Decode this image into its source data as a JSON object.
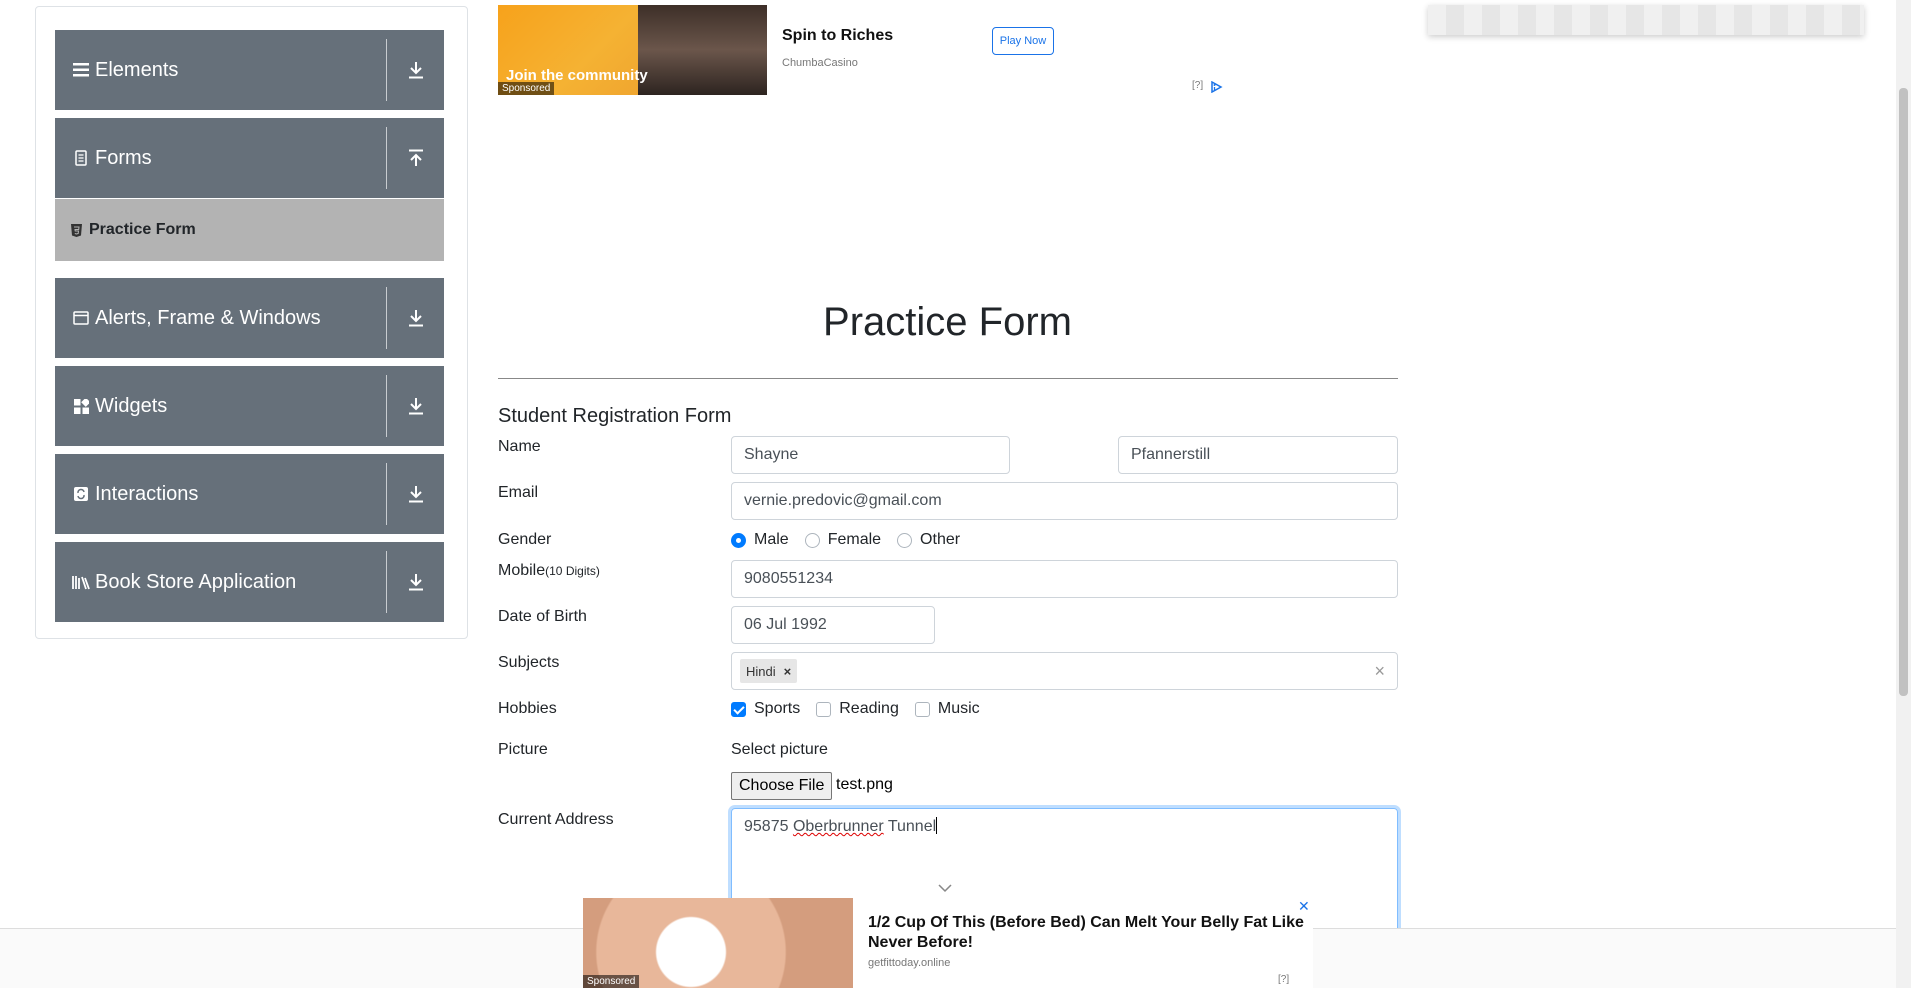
{
  "sidebar": {
    "groups": [
      {
        "label": "Elements",
        "icon": "bars-icon",
        "arrow": "download-icon"
      },
      {
        "label": "Forms",
        "icon": "document-icon",
        "arrow": "upload-icon"
      },
      {
        "label": "Alerts, Frame & Windows",
        "icon": "window-icon",
        "arrow": "download-icon"
      },
      {
        "label": "Widgets",
        "icon": "widgets-icon",
        "arrow": "download-icon"
      },
      {
        "label": "Interactions",
        "icon": "interactions-icon",
        "arrow": "download-icon"
      },
      {
        "label": "Book Store Application",
        "icon": "books-icon",
        "arrow": "download-icon"
      }
    ],
    "active_item": {
      "label": "Practice Form",
      "icon": "html5-icon"
    }
  },
  "ad_top": {
    "image_text": "Join the community",
    "sponsored": "Sponsored",
    "title": "Spin to Riches",
    "source": "ChumbaCasino",
    "button": "Play Now",
    "info": "[?]"
  },
  "form": {
    "page_title": "Practice Form",
    "subtitle": "Student Registration Form",
    "labels": {
      "name": "Name",
      "email": "Email",
      "gender": "Gender",
      "mobile": "Mobile",
      "mobile_hint": "(10 Digits)",
      "dob": "Date of Birth",
      "subjects": "Subjects",
      "hobbies": "Hobbies",
      "picture": "Picture",
      "address": "Current Address"
    },
    "first_name": "Shayne",
    "last_name": "Pfannerstill",
    "email": "vernie.predovic@gmail.com",
    "gender_options": [
      "Male",
      "Female",
      "Other"
    ],
    "gender_selected": "Male",
    "mobile": "9080551234",
    "dob": "06 Jul 1992",
    "subjects": [
      "Hindi"
    ],
    "hobbies": [
      {
        "label": "Sports",
        "checked": true
      },
      {
        "label": "Reading",
        "checked": false
      },
      {
        "label": "Music",
        "checked": false
      }
    ],
    "picture_label": "Select picture",
    "file_button": "Choose File",
    "file_name": "test.png",
    "address_number": "95875",
    "address_word": "Oberbrunner",
    "address_rest": "Tunnel"
  },
  "ad_bottom": {
    "title": "1/2 Cup Of This (Before Bed) Can Melt Your Belly Fat Like Never Before!",
    "source": "getfittoday.online",
    "sponsored": "Sponsored",
    "info": "[?]",
    "close": "✕"
  },
  "colors": {
    "sidebar_bg": "#66707a",
    "active_item_bg": "#b3b3b3",
    "accent": "#007bff"
  }
}
